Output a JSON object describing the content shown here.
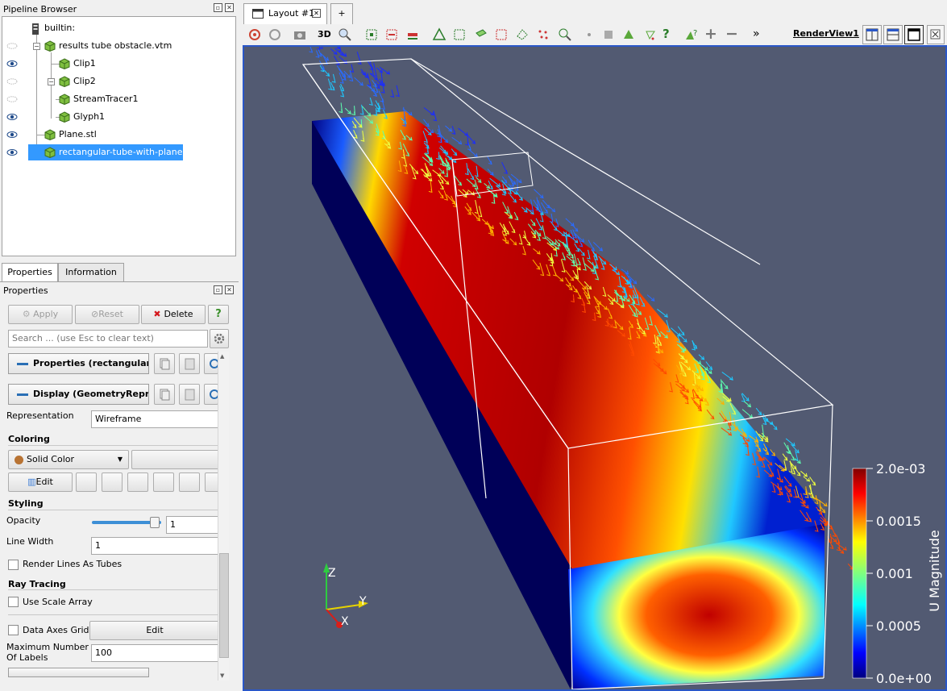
{
  "pipeline": {
    "title": "Pipeline Browser",
    "items": [
      {
        "label": "builtin:",
        "visible": null
      },
      {
        "label": "results tube obstacle.vtm",
        "visible": false
      },
      {
        "label": "Clip1",
        "visible": true
      },
      {
        "label": "Clip2",
        "visible": false
      },
      {
        "label": "StreamTracer1",
        "visible": false
      },
      {
        "label": "Glyph1",
        "visible": true
      },
      {
        "label": "Plane.stl",
        "visible": true
      },
      {
        "label": "rectangular-tube-with-plane.stl",
        "visible": true,
        "selected": true
      }
    ]
  },
  "tabs": {
    "properties": "Properties",
    "information": "Information"
  },
  "properties": {
    "title": "Properties",
    "apply": "Apply",
    "reset": "Reset",
    "delete": "Delete",
    "help": "?",
    "search_placeholder": "Search ... (use Esc to clear text)",
    "section_properties": "Properties (rectangular",
    "section_display": "Display (GeometryRepr",
    "representation_label": "Representation",
    "representation_value": "Wireframe",
    "coloring_header": "Coloring",
    "coloring_value": "Solid Color",
    "edit": "Edit",
    "styling_header": "Styling",
    "opacity_label": "Opacity",
    "opacity_value": "1",
    "linewidth_label": "Line Width",
    "linewidth_value": "1",
    "render_tubes": "Render Lines As Tubes",
    "raytracing_header": "Ray Tracing",
    "scale_array": "Use Scale Array",
    "data_axes_grid": "Data Axes Grid",
    "data_axes_edit": "Edit",
    "max_labels_label": "Maximum Number Of Labels",
    "max_labels_value": "100"
  },
  "layout": {
    "tab_label": "Layout #1",
    "add_tab": "+",
    "view_name": "RenderView1",
    "threeD": "3D",
    "more": "»"
  },
  "colorbar": {
    "title": "U Magnitude",
    "ticks": [
      "2.0e-03",
      "0.0015",
      "0.001",
      "0.0005",
      "0.0e+00"
    ]
  },
  "axes": {
    "z": "Z",
    "y": "Y",
    "x": "X"
  },
  "colors": {
    "selection": "#3399ff",
    "background": "#525a72",
    "accent": "#2a57c8"
  }
}
